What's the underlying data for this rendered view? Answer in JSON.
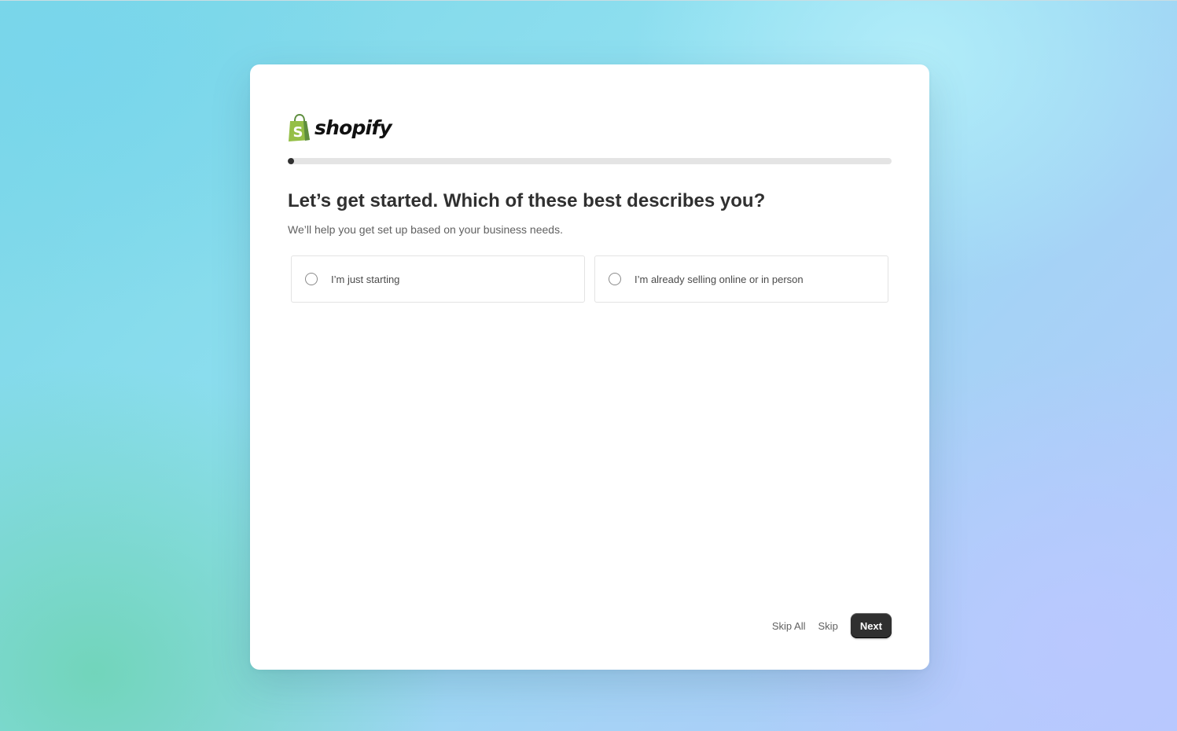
{
  "brand": {
    "name": "shopify",
    "logo_icon": "shopping-bag-icon",
    "logo_color": "#95bf47",
    "logo_dark": "#5e8e3e"
  },
  "progress": {
    "value_percent": 1
  },
  "question": {
    "title": "Let’s get started. Which of these best describes you?",
    "subtitle": "We’ll help you get set up based on your business needs."
  },
  "options": [
    {
      "label": "I’m just starting",
      "selected": false
    },
    {
      "label": "I’m already selling online or in person",
      "selected": false
    }
  ],
  "footer": {
    "skip_all_label": "Skip All",
    "skip_label": "Skip",
    "next_label": "Next"
  },
  "colors": {
    "primary_button": "#303030",
    "text": "#303030",
    "muted_text": "#616161"
  }
}
